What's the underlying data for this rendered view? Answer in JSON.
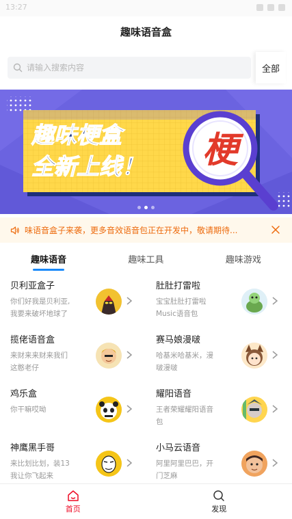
{
  "status_bar": {
    "time": "13:27"
  },
  "header": {
    "title": "趣味语音盒"
  },
  "search": {
    "placeholder": "请输入搜索内容",
    "scope": "全部",
    "search_icon": "search-icon"
  },
  "banner": {
    "line1": "趣味梗盒",
    "line2": "全新上线！",
    "badge_char": "梗",
    "page_count": 3,
    "active_page": 2,
    "colors": {
      "bg": "#6b63e0",
      "panel": "#ffd84a",
      "text": "#1f3a8a",
      "badge": "#e23a2a"
    }
  },
  "notice": {
    "text": "味语音盒子来袭，更多音效语音包正在开发中，敬请期待...",
    "icon": "speaker-icon",
    "close_icon": "close-icon",
    "color": "#ed6a0c",
    "bg": "#fff8ec"
  },
  "tabs": [
    {
      "label": "趣味语音",
      "active": true
    },
    {
      "label": "趣味工具",
      "active": false
    },
    {
      "label": "趣味游戏",
      "active": false
    }
  ],
  "voice_packs": [
    {
      "name": "贝利亚盒子",
      "desc": "你们好我是贝利亚,我要来破坏地球了",
      "avatar": "ultraman-belial-avatar"
    },
    {
      "name": "肚肚打雷啦",
      "desc": "宝宝肚肚打雷啦Music语音包",
      "avatar": "turtle-avatar"
    },
    {
      "name": "揽佬语音盒",
      "desc": "来财来来财来我们这憨老仔",
      "avatar": "cartoon-boy-avatar"
    },
    {
      "name": "赛马娘漫啵",
      "desc": "哈基米哈基米，漫啵漫啵",
      "avatar": "horse-girl-avatar"
    },
    {
      "name": "鸡乐盒",
      "desc": "你干嘛哎呦",
      "avatar": "panda-avatar"
    },
    {
      "name": "耀阳语音",
      "desc": "王者荣耀耀阳语音包",
      "avatar": "hero-avatar"
    },
    {
      "name": "神鹰黑手哥",
      "desc": "来比划比划，装13我让你飞起来",
      "avatar": "sketch-face-avatar"
    },
    {
      "name": "小马云语音",
      "desc": "阿里阿里巴巴，开门芝麻",
      "avatar": "kid-face-avatar"
    }
  ],
  "bottom_nav": [
    {
      "label": "首页",
      "icon": "home-icon",
      "active": true
    },
    {
      "label": "发现",
      "icon": "search-icon",
      "active": false
    }
  ],
  "accent": {
    "tab_underline": "#1989fa",
    "nav_active": "#ee0a24"
  }
}
